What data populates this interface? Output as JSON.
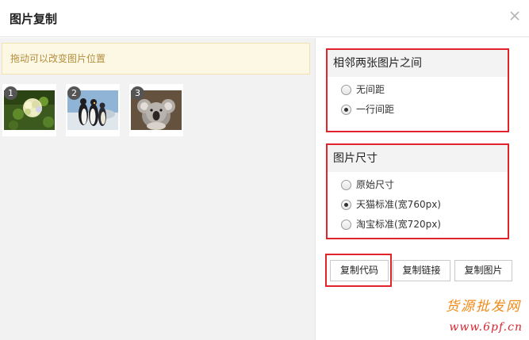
{
  "dialog": {
    "title": "图片复制",
    "close_icon": "close-icon"
  },
  "left": {
    "hint": "拖动可以改变图片位置",
    "thumbnails": [
      {
        "number": "1",
        "subject": "flowers"
      },
      {
        "number": "2",
        "subject": "penguins"
      },
      {
        "number": "3",
        "subject": "koala"
      }
    ]
  },
  "spacing": {
    "heading": "相邻两张图片之间",
    "options": [
      {
        "label": "无间距",
        "checked": false
      },
      {
        "label": "一行间距",
        "checked": true
      }
    ]
  },
  "size": {
    "heading": "图片尺寸",
    "options": [
      {
        "label": "原始尺寸",
        "checked": false
      },
      {
        "label": "天猫标准(宽760px)",
        "checked": true
      },
      {
        "label": "淘宝标准(宽720px)",
        "checked": false
      }
    ]
  },
  "actions": {
    "copy_code": "复制代码",
    "copy_link": "复制链接",
    "copy_image": "复制图片"
  },
  "watermark": {
    "line1": "货源批发网",
    "line2": "www.6pf.cn"
  },
  "colors": {
    "highlight_border": "#e0242a",
    "hint_bg": "#fcf8e3",
    "hint_text": "#b48d3e"
  }
}
